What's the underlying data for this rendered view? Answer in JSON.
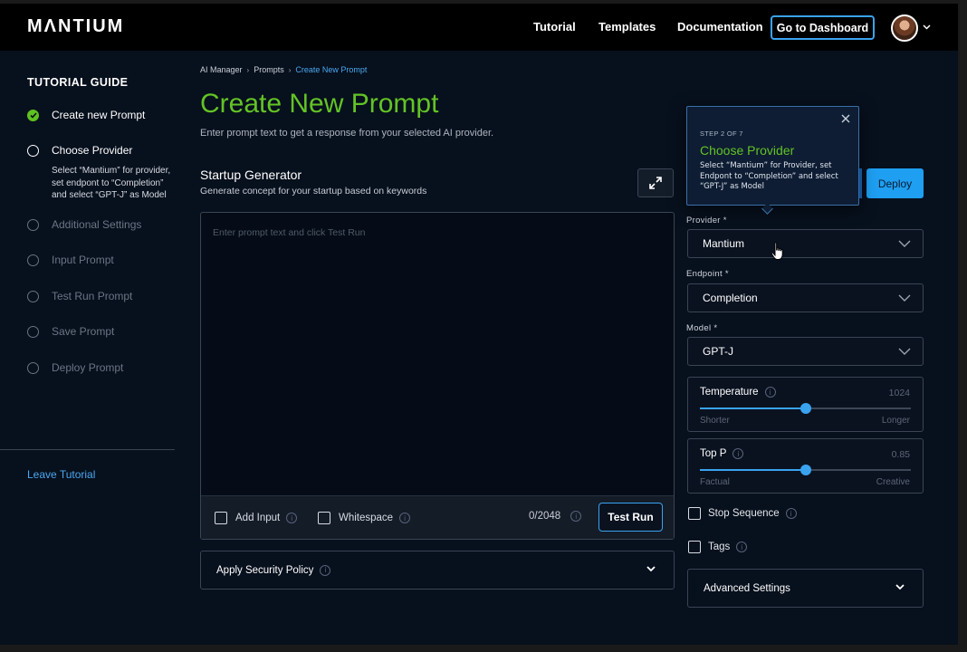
{
  "nav": {
    "logo": "MΛNTIUM",
    "links": [
      "Tutorial",
      "Templates",
      "Documentation"
    ],
    "dashboard_button": "Go to Dashboard"
  },
  "sidebar": {
    "title": "TUTORIAL GUIDE",
    "steps": [
      {
        "label": "Create new Prompt",
        "state": "done"
      },
      {
        "label": "Choose Provider",
        "state": "active"
      },
      {
        "label": "Additional Settings",
        "state": "pending"
      },
      {
        "label": "Input Prompt",
        "state": "pending"
      },
      {
        "label": "Test Run Prompt",
        "state": "pending"
      },
      {
        "label": "Save Prompt",
        "state": "pending"
      },
      {
        "label": "Deploy Prompt",
        "state": "pending"
      }
    ],
    "active_step_description": "Select “Mantium” for provider, set endpont to “Completion” and select “GPT-J” as Model",
    "leave_link": "Leave Tutorial"
  },
  "breadcrumb": {
    "items": [
      "AI Manager",
      "Prompts",
      "Create New Prompt"
    ],
    "separator": "›"
  },
  "main": {
    "title": "Create New Prompt",
    "subtitle": "Enter prompt text to get a response from your selected AI provider.",
    "prompt_name": "Startup Generator",
    "prompt_description": "Generate concept for your startup based on keywords",
    "editor_placeholder": "Enter prompt text and click Test Run",
    "add_input_label": "Add Input",
    "whitespace_label": "Whitespace",
    "char_count": "0/2048",
    "test_run_button": "Test Run",
    "security_policy_label": "Apply Security Policy"
  },
  "right_panel": {
    "deploy_button": "Deploy",
    "provider": {
      "label": "Provider *",
      "value": "Mantium"
    },
    "endpoint": {
      "label": "Endpoint *",
      "value": "Completion"
    },
    "model": {
      "label": "Model *",
      "value": "GPT-J"
    },
    "temperature": {
      "title": "Temperature",
      "value": "1024",
      "fraction": 0.5,
      "min_label": "Shorter",
      "max_label": "Longer"
    },
    "top_p": {
      "title": "Top P",
      "value": "0.85",
      "fraction": 0.5,
      "min_label": "Factual",
      "max_label": "Creative"
    },
    "stop_sequence_label": "Stop Sequence",
    "tags_label": "Tags",
    "advanced_settings_label": "Advanced Settings"
  },
  "tooltip": {
    "step": "STEP 2 OF 7",
    "title": "Choose Provider",
    "body": "Select “Mantium” for Provider, set Endpont to “Completion” and select “GPT-J” as Model"
  },
  "colors": {
    "accent_blue": "#3aa3f0",
    "title_green": "#63c325",
    "background": "#07101d"
  }
}
